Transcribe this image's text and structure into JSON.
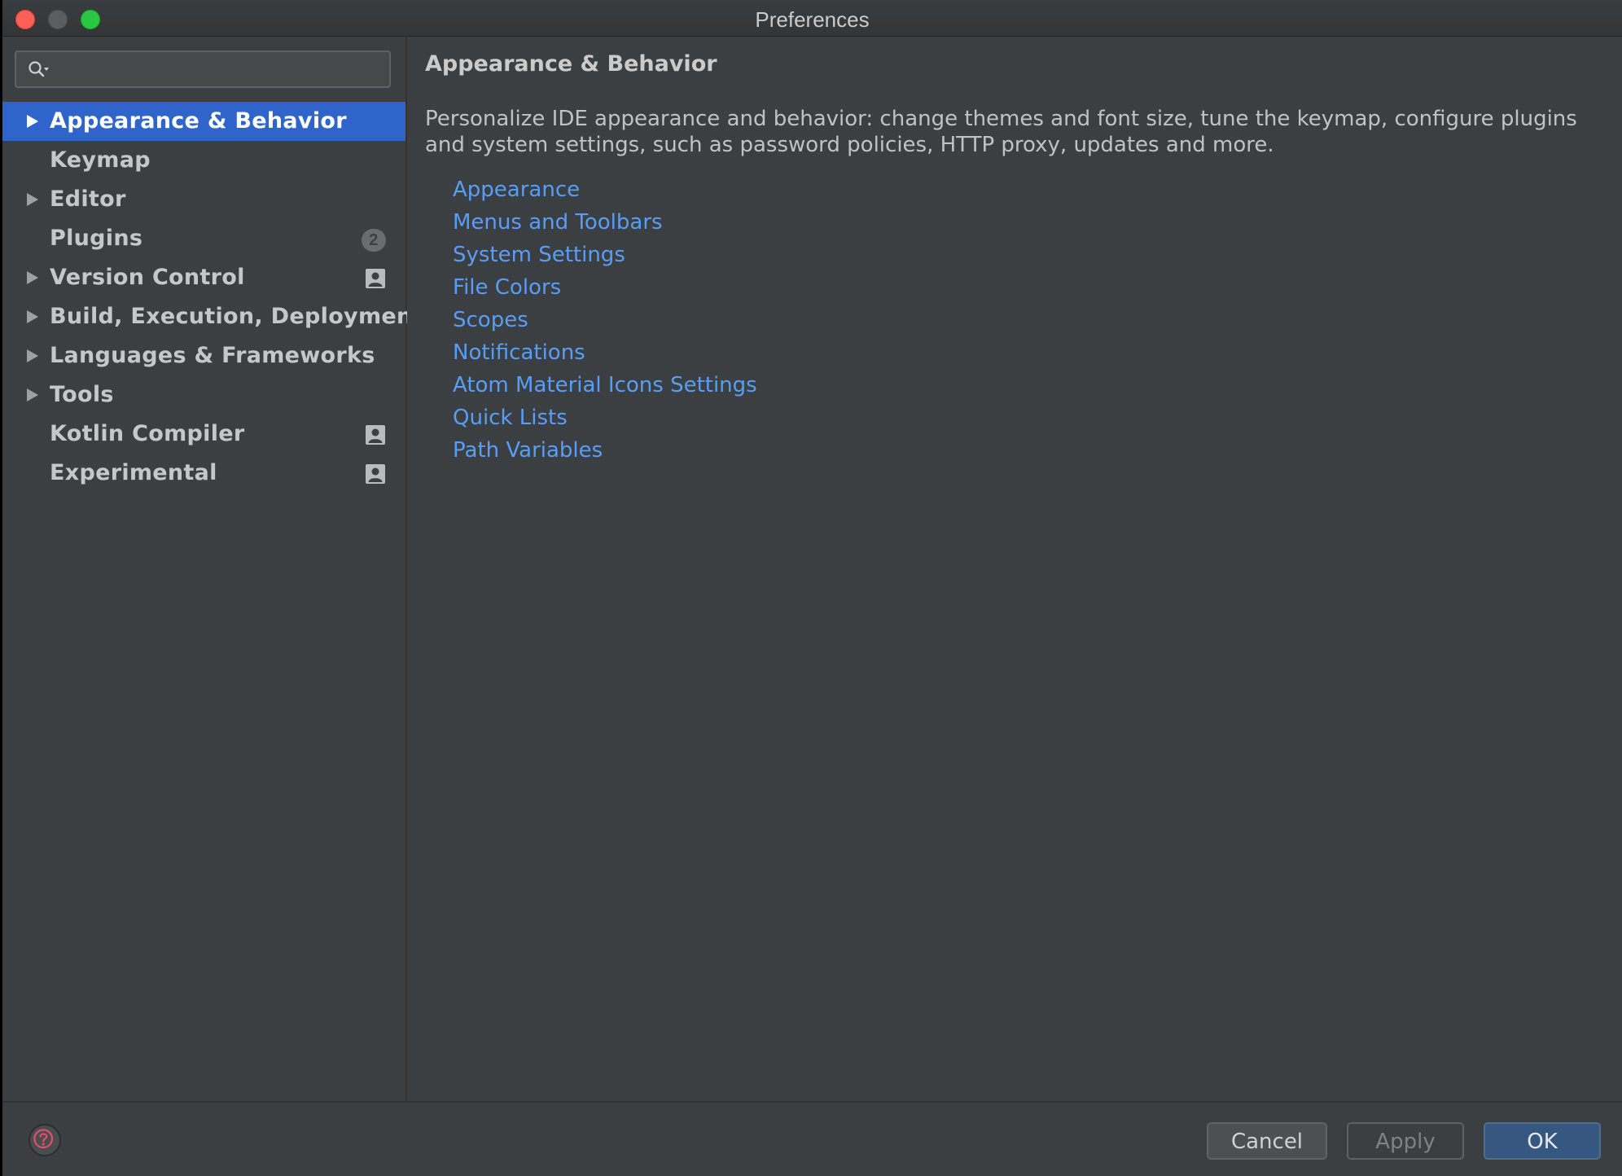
{
  "window": {
    "title": "Preferences"
  },
  "search": {
    "value": "",
    "placeholder": ""
  },
  "sidebar": {
    "items": [
      {
        "label": "Appearance & Behavior",
        "expandable": true,
        "selected": true
      },
      {
        "label": "Keymap",
        "expandable": false
      },
      {
        "label": "Editor",
        "expandable": true
      },
      {
        "label": "Plugins",
        "expandable": false,
        "badge": "2"
      },
      {
        "label": "Version Control",
        "expandable": true,
        "icon": "project-icon"
      },
      {
        "label": "Build, Execution, Deployment",
        "expandable": true
      },
      {
        "label": "Languages & Frameworks",
        "expandable": true
      },
      {
        "label": "Tools",
        "expandable": true
      },
      {
        "label": "Kotlin Compiler",
        "expandable": false,
        "icon": "project-icon"
      },
      {
        "label": "Experimental",
        "expandable": false,
        "icon": "project-icon"
      }
    ]
  },
  "main": {
    "heading": "Appearance & Behavior",
    "description": "Personalize IDE appearance and behavior: change themes and font size, tune the keymap, configure plugins and system settings, such as password policies, HTTP proxy, updates and more.",
    "links": [
      "Appearance",
      "Menus and Toolbars",
      "System Settings",
      "File Colors",
      "Scopes",
      "Notifications",
      "Atom Material Icons Settings",
      "Quick Lists",
      "Path Variables"
    ]
  },
  "footer": {
    "cancel_label": "Cancel",
    "apply_label": "Apply",
    "ok_label": "OK"
  },
  "colors": {
    "selection": "#2f65ca",
    "link": "#589df6",
    "background": "#3c3f41",
    "ok_button": "#365880"
  }
}
